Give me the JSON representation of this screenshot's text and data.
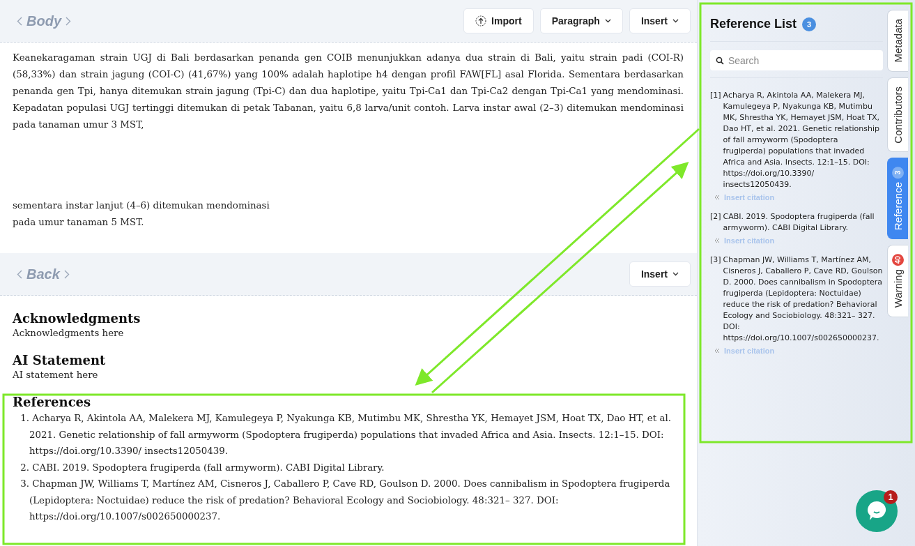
{
  "body_section": {
    "title": "Body",
    "buttons": [
      {
        "kind": "import",
        "label": "Import"
      },
      {
        "kind": "dropdown",
        "label": "Paragraph"
      },
      {
        "kind": "dropdown",
        "label": "Insert"
      }
    ],
    "paragraphs": [
      {
        "lines": [
          "Keanekaragaman strain UGJ di Bali berdasarkan penanda gen COIB menunjukkan adanya dua strain di Bali, yaitu strain padi (COI-R) (58,33%) dan strain jagung (COI-C) (41,67%) yang 100% adalah haplotipe h4 dengan profil FAW[FL] asal Florida. Sementara berdasarkan penanda gen Tpi, hanya ditemukan strain jagung (Tpi-C) dan dua haplotipe, yaitu Tpi-Ca1 dan Tpi-Ca2 dengan Tpi-Ca1 yang mendominasi. Kepadatan populasi UGJ tertinggi ditemukan di petak Tabanan, yaitu 6,8 larva/unit contoh. Larva instar awal (2–3) ditemukan mendominasi pada tanaman umur 3 MST,"
        ]
      },
      {
        "lines": [
          "sementara instar lanjut (4–6) ditemukan mendominasi",
          "pada umur tanaman 5 MST."
        ]
      }
    ]
  },
  "back_section": {
    "title": "Back",
    "buttons": [
      {
        "kind": "dropdown",
        "label": "Insert"
      }
    ],
    "blocks": [
      {
        "heading": "Acknowledgments",
        "text": "Acknowledgments here"
      },
      {
        "heading": "AI Statement",
        "text": "AI statement here"
      }
    ],
    "references": {
      "heading": "References",
      "items": [
        {
          "number": "1.",
          "text": "Acharya R, Akintola AA, Malekera MJ, Kamulegeya P, Nyakunga KB, Mutimbu MK, Shrestha YK, Hemayet JSM, Hoat TX, Dao HT, et al. 2021. Genetic relationship of fall armyworm (Spodoptera frugiperda) populations that invaded Africa and Asia. Insects. 12:1–15. DOI: https://doi.org/10.3390/ insects12050439."
        },
        {
          "number": "2.",
          "text": "CABI. 2019. Spodoptera frugiperda (fall armyworm).  CABI Digital Library."
        },
        {
          "number": "3.",
          "text": "Chapman JW, Williams T, Martínez AM, Cisneros J, Caballero P, Cave RD, Goulson D. 2000. Does cannibalism in Spodoptera frugiperda (Lepidoptera: Noctuidae) reduce the risk of predation? Behavioral Ecology and Sociobiology. 48:321– 327. DOI: https://doi.org/10.1007/s002650000237."
        }
      ]
    }
  },
  "reference_panel": {
    "title": "Reference List",
    "count": "3",
    "search": {
      "placeholder": "Search"
    },
    "items": [
      {
        "number": "[1]",
        "text": "Acharya R, Akintola AA, Malekera MJ, Kamulegeya P, Nyakunga KB, Mutimbu MK, Shrestha YK, Hemayet JSM, Hoat TX, Dao HT, et al. 2021. Genetic relationship of fall armyworm (Spodoptera frugiperda) populations that invaded Africa and Asia. Insects. 12:1–15. DOI: https://doi.org/10.3390/ insects12050439.",
        "action": "Insert citation"
      },
      {
        "number": "[2]",
        "text": "CABI. 2019. Spodoptera frugiperda (fall armyworm). CABI Digital Library.",
        "action": "Insert citation"
      },
      {
        "number": "[3]",
        "text": "Chapman JW, Williams T, Martínez AM, Cisneros J, Caballero P, Cave RD, Goulson D. 2000. Does cannibalism in Spodoptera frugiperda (Lepidoptera: Noctuidae) reduce the risk of predation? Behavioral Ecology and Sociobiology. 48:321– 327. DOI: https://doi.org/10.1007/s002650000237.",
        "action": "Insert citation"
      }
    ]
  },
  "side_tabs": [
    {
      "label": "Metadata",
      "selected": false
    },
    {
      "label": "Contributors",
      "selected": false
    },
    {
      "label": "Reference",
      "badge": "3",
      "selected": true
    },
    {
      "label": "Warning",
      "badge": "40",
      "selected": false
    }
  ],
  "chat_button": {
    "badge": "1"
  }
}
